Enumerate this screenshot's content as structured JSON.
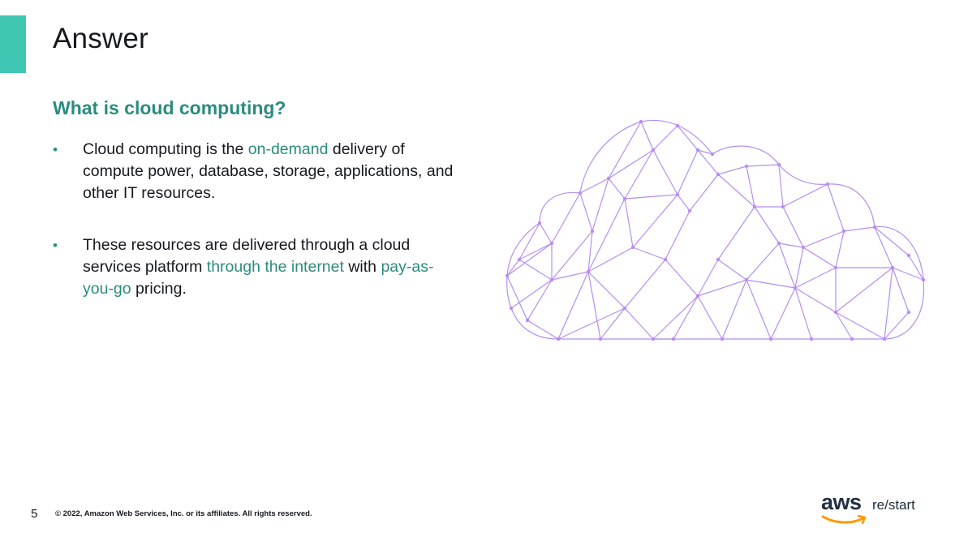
{
  "slide": {
    "title": "Answer",
    "question": "What is cloud computing?",
    "page_number": "5",
    "copyright": "© 2022, Amazon Web Services, Inc. or its affiliates. All rights reserved."
  },
  "bullets": [
    {
      "p1": "Cloud computing is the ",
      "h1": "on-demand",
      "p2": " delivery of compute power, database, storage, applications, and other IT resources."
    },
    {
      "p1": "These resources are delivered through a cloud services platform ",
      "h1": "through the internet",
      "p2": " with ",
      "h2": "pay-as-you-go",
      "p3": " pricing."
    }
  ],
  "bullet_symbol": "•",
  "logo": {
    "aws": "aws",
    "restart": "re/start"
  },
  "colors": {
    "accent_bar": "#3ec6b2",
    "highlight_text": "#2a8c7e",
    "cloud_mesh": "#b78ef0",
    "aws_smile": "#ff9900"
  },
  "icons": {
    "cloud": "cloud-mesh-icon",
    "logo_smile": "aws-smile-icon"
  }
}
